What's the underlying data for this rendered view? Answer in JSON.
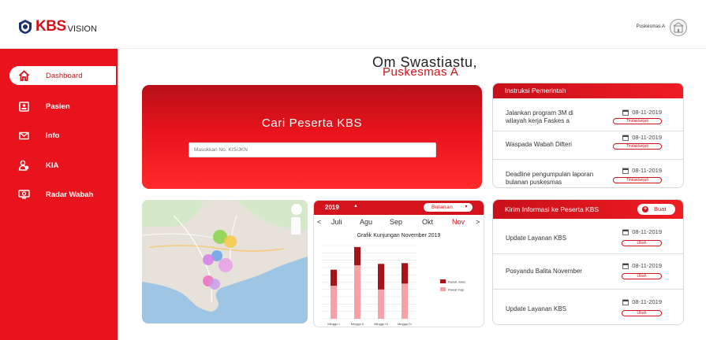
{
  "header": {
    "logo_kbs": "KBS",
    "logo_vision": "VISION",
    "user_name": "Puskesmas A"
  },
  "sidebar": {
    "items": [
      {
        "label": "Dashboard",
        "icon": "home-icon",
        "active": true
      },
      {
        "label": "Pasien",
        "icon": "patient-card-icon",
        "active": false
      },
      {
        "label": "Info",
        "icon": "mail-icon",
        "active": false
      },
      {
        "label": "KIA",
        "icon": "mother-child-icon",
        "active": false
      },
      {
        "label": "Radar Wabah",
        "icon": "radar-screen-icon",
        "active": false
      }
    ]
  },
  "greeting": {
    "line1": "Om Swastiastu,",
    "line2": "Puskesmas A"
  },
  "search": {
    "title": "Cari Peserta KBS",
    "placeholder": "Masukkan No. KIS/JKN"
  },
  "calendar": {
    "year": "2019",
    "mode": "Bulanan",
    "prev": "<",
    "next": ">",
    "months": [
      "Juli",
      "Agu",
      "Sep",
      "Okt",
      "Nov"
    ],
    "selected_month": "Nov"
  },
  "chart_data": {
    "type": "bar",
    "title": "Grafik Kunjungan November 2019",
    "categories": [
      "Minggu I",
      "Minggu II",
      "Minggu III",
      "Minggu IV"
    ],
    "series": [
      {
        "name": "Rawat Inap",
        "values": [
          45,
          73,
          40,
          48
        ],
        "color": "#f4a2a6"
      },
      {
        "name": "Rawat Jalan",
        "values": [
          22,
          25,
          35,
          28
        ],
        "color": "#a8131b"
      }
    ],
    "stacked": true,
    "ylim": [
      0,
      100
    ],
    "legend": "right",
    "grid": true
  },
  "instruksi": {
    "title": "Instruksi Pemerintah",
    "items": [
      {
        "line1": "Jalankan program 3M di",
        "line2": "wilayah kerja Faskes a",
        "date": "08-11-2019",
        "action": "Tindaklanjuti"
      },
      {
        "line1": "Waspada Wabah Difteri",
        "line2": "",
        "date": "08-11-2019",
        "action": "Tindaklanjuti"
      },
      {
        "line1": "Deadline pengumpulan laporan",
        "line2": "bulanan puskesmas",
        "date": "08-11-2019",
        "action": "Tindaklanjuti"
      }
    ]
  },
  "kirim": {
    "title": "Kirim Informasi ke Peserta KBS",
    "buat_label": "Buat",
    "items": [
      {
        "text": "Update Layanan KBS",
        "date": "08-11-2019",
        "action": "Ubah"
      },
      {
        "text": "Posyandu Balita November",
        "date": "08-11-2019",
        "action": "Ubah"
      },
      {
        "text": "Update Layanan KBS",
        "date": "08-11-2019",
        "action": "Ubah"
      }
    ]
  },
  "colors": {
    "brand_red": "#e8131d",
    "dark_red": "#d3121b"
  }
}
